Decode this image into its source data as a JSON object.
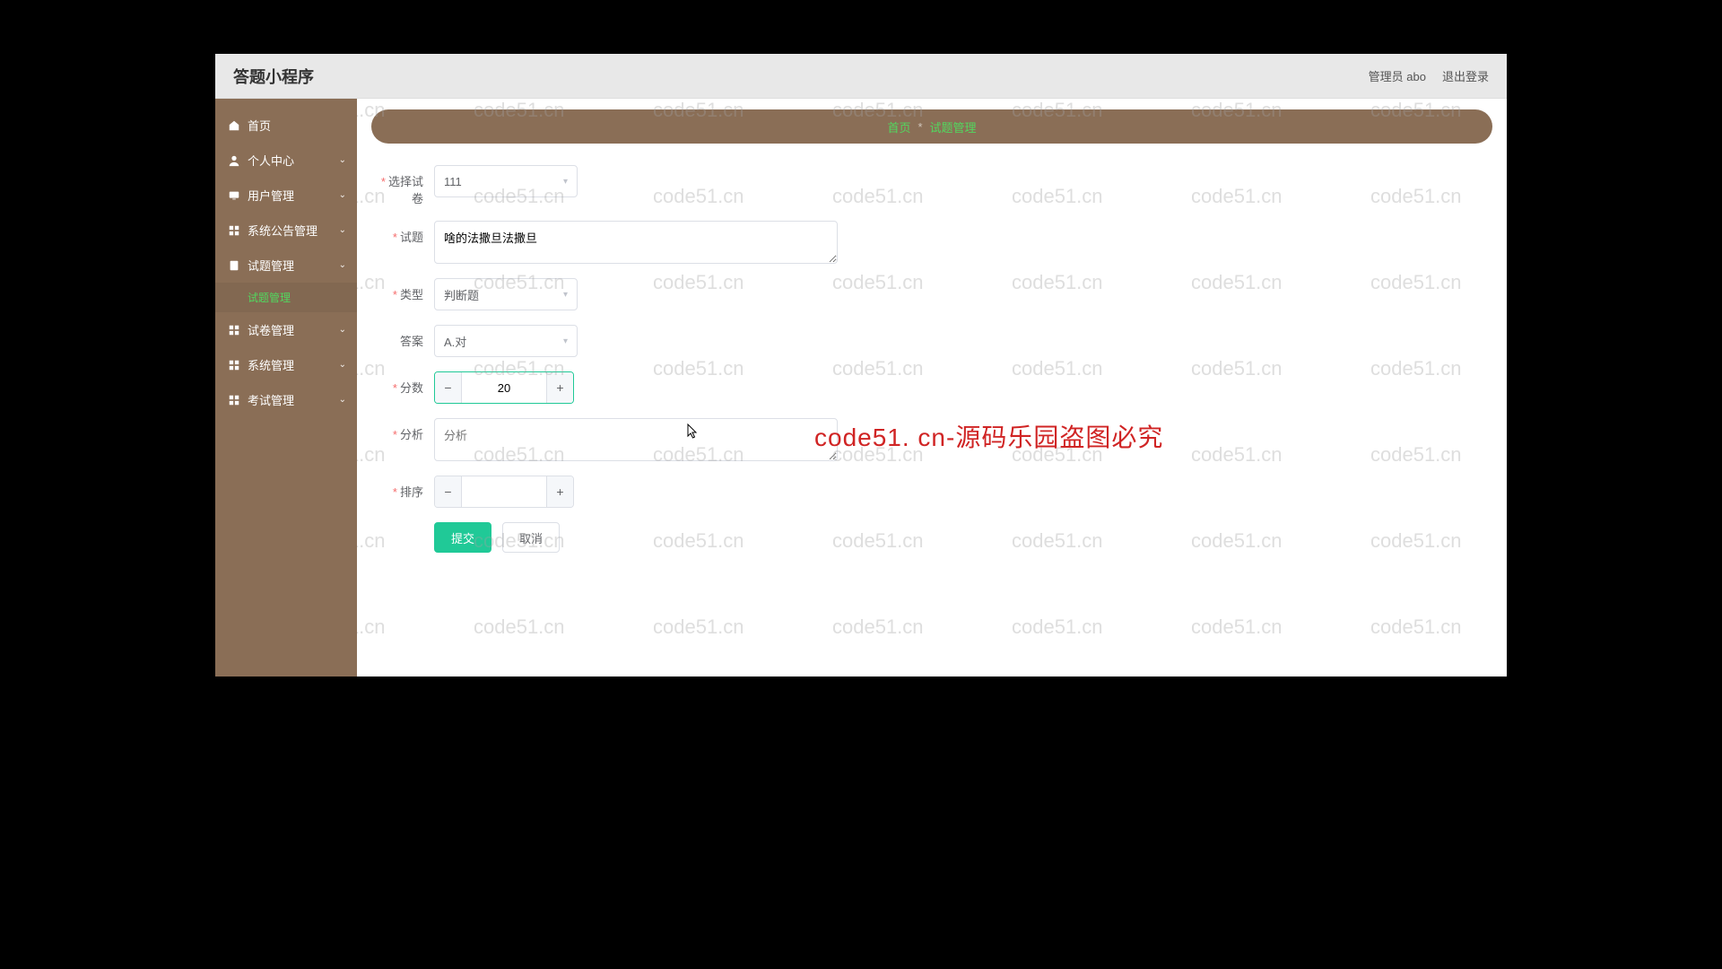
{
  "header": {
    "title": "答题小程序",
    "user_label": "管理员 abo",
    "logout": "退出登录"
  },
  "sidebar": {
    "items": [
      {
        "icon": "home",
        "label": "首页",
        "hasChildren": false
      },
      {
        "icon": "user",
        "label": "个人中心",
        "hasChildren": true
      },
      {
        "icon": "screen",
        "label": "用户管理",
        "hasChildren": true
      },
      {
        "icon": "grid",
        "label": "系统公告管理",
        "hasChildren": true
      },
      {
        "icon": "doc",
        "label": "试题管理",
        "hasChildren": true,
        "expanded": true
      },
      {
        "icon": "grid",
        "label": "试卷管理",
        "hasChildren": true
      },
      {
        "icon": "grid",
        "label": "系统管理",
        "hasChildren": true
      },
      {
        "icon": "grid",
        "label": "考试管理",
        "hasChildren": true
      }
    ],
    "active_sub": "试题管理"
  },
  "breadcrumb": {
    "home": "首页",
    "sep": "*",
    "current": "试题管理"
  },
  "form": {
    "select_paper": {
      "label": "选择试卷",
      "value": "111"
    },
    "question": {
      "label": "试题",
      "value": "啥的法撒旦法撒旦"
    },
    "type": {
      "label": "类型",
      "value": "判断题"
    },
    "answer": {
      "label": "答案",
      "value": "A.对"
    },
    "score": {
      "label": "分数",
      "value": "20"
    },
    "analysis": {
      "label": "分析",
      "placeholder": "分析",
      "value": ""
    },
    "sort": {
      "label": "排序",
      "value": ""
    },
    "submit": "提交",
    "cancel": "取消"
  },
  "watermark": {
    "text": "code51.cn",
    "banner": "code51. cn-源码乐园盗图必究"
  }
}
